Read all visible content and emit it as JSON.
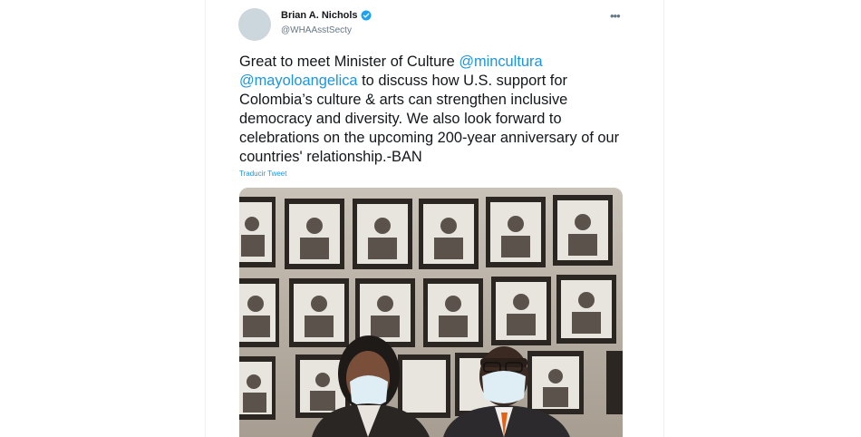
{
  "tweet": {
    "author_name": "Brian A. Nichols",
    "handle": "@WHAAsstSecty",
    "more_icon": "more-horizontal-icon",
    "text_parts": [
      "Great to meet Minister of Culture ",
      "@mincultura",
      " ",
      "@mayoloangelica",
      " to discuss how U.S. support for Colombia’s culture & arts can strengthen inclusive democracy and diversity. We also look forward to celebrations on the upcoming 200-year anniversary of our countries' relationship.-BAN"
    ],
    "translate_label": "Traducir Tweet"
  },
  "colors": {
    "link": "#1b95e0",
    "text": "#14171a",
    "secondary": "#657786",
    "verified": "#1da1f2"
  }
}
